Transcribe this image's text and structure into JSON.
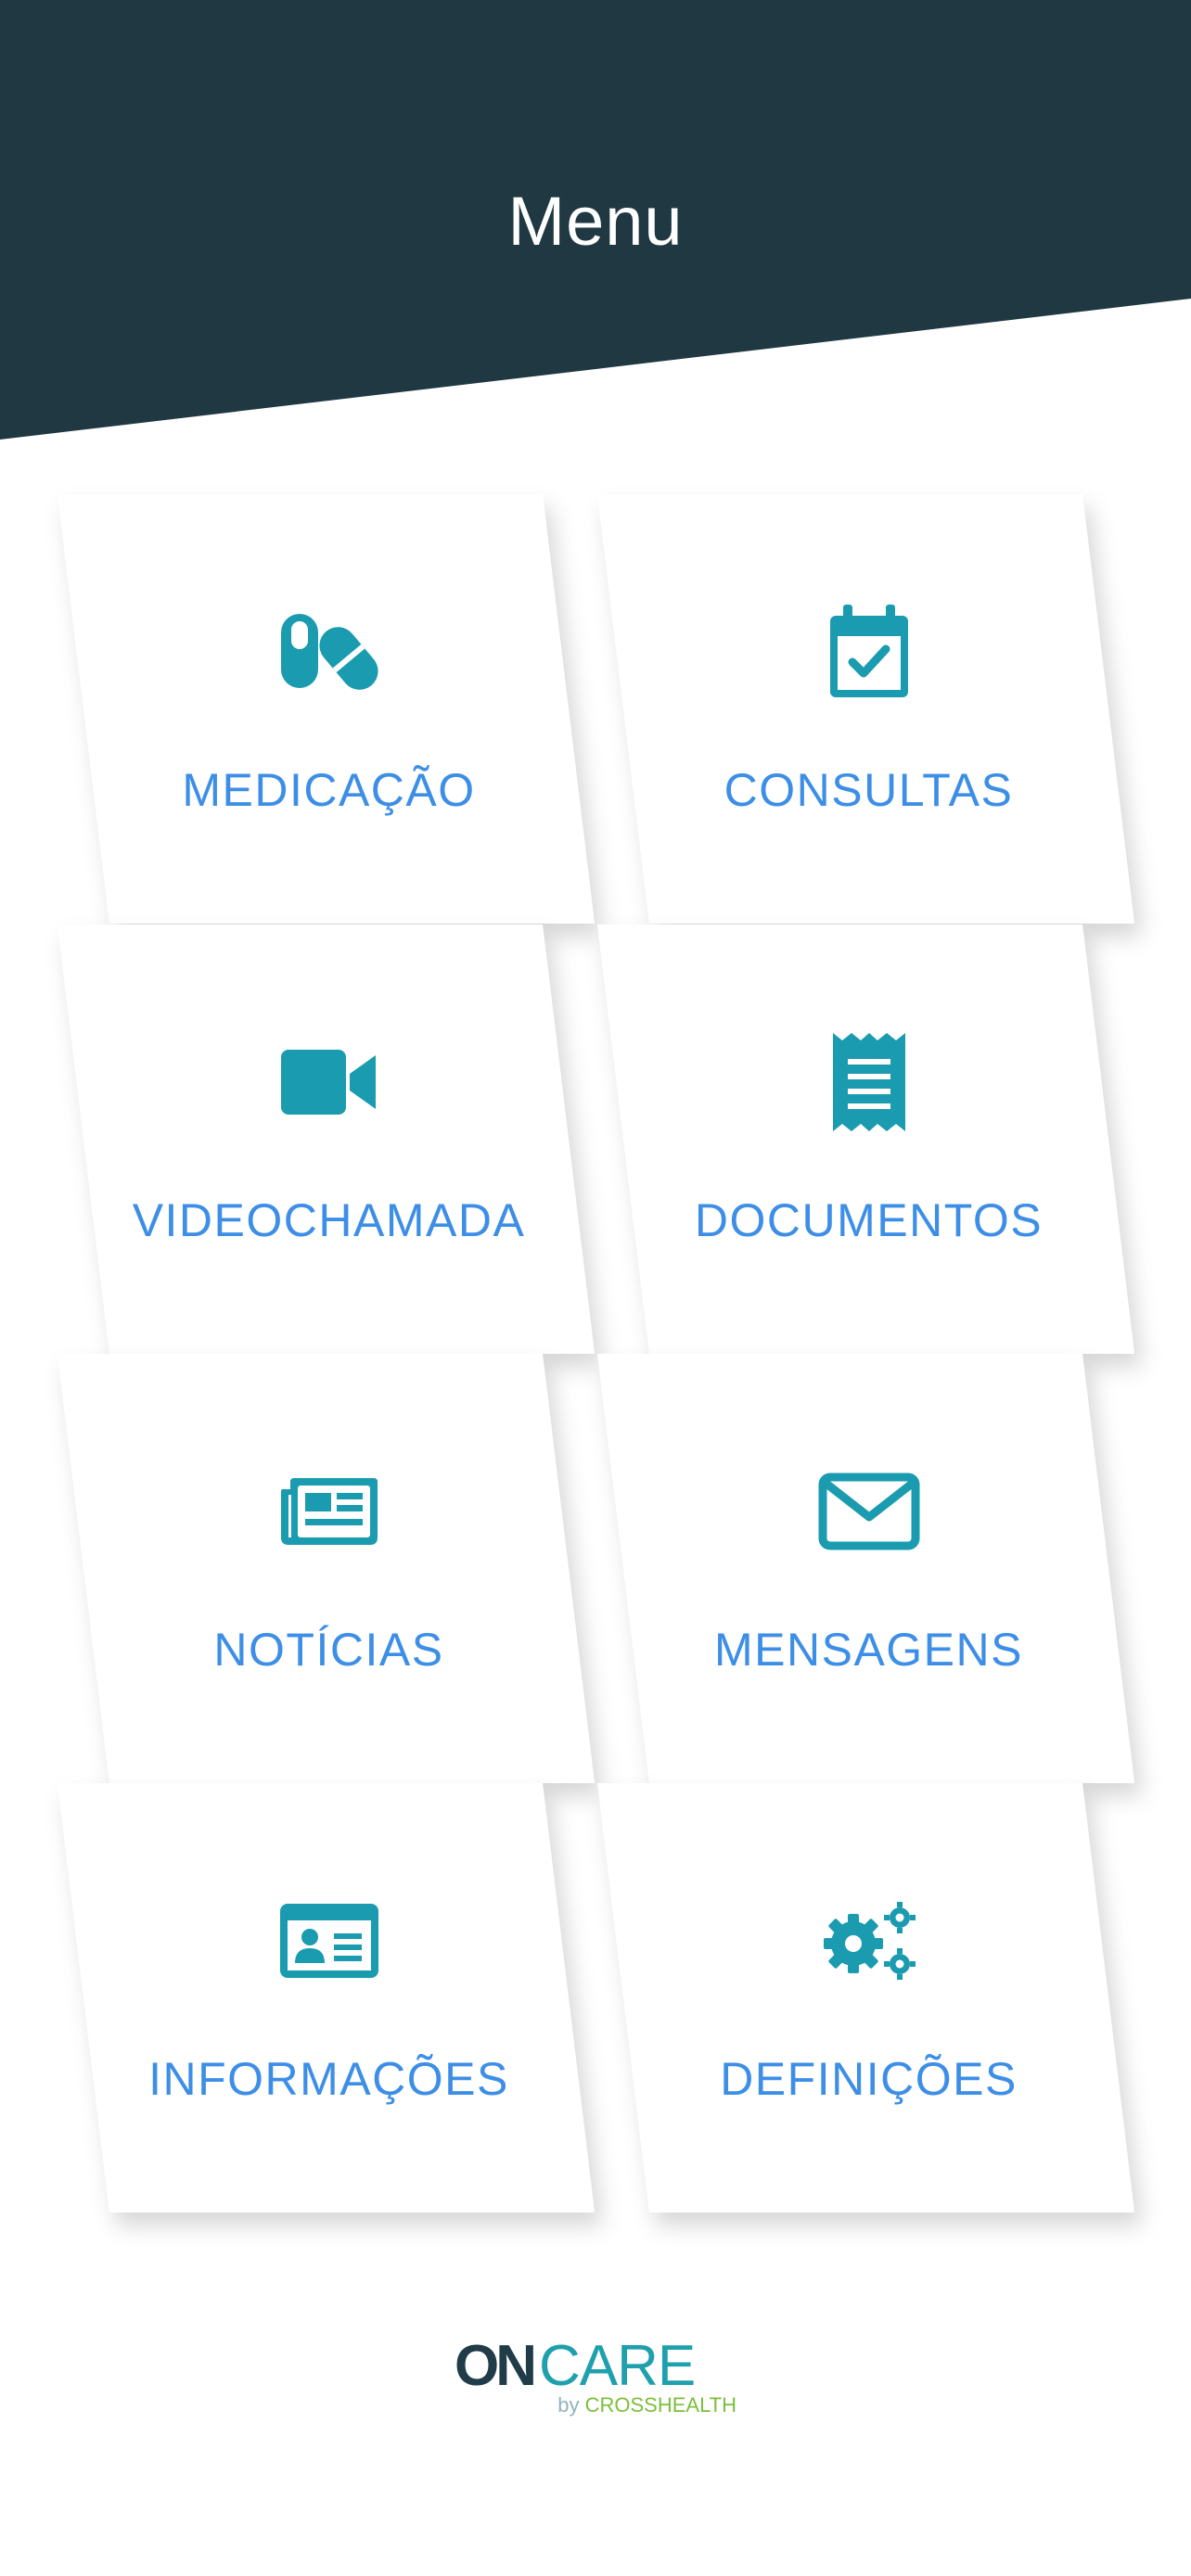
{
  "header": {
    "title": "Menu",
    "background_color": "#1f3842"
  },
  "menu": {
    "items": [
      {
        "label": "MEDICAÇÃO",
        "icon": "pills-icon"
      },
      {
        "label": "CONSULTAS",
        "icon": "calendar-check-icon"
      },
      {
        "label": "VIDEOCHAMADA",
        "icon": "video-camera-icon"
      },
      {
        "label": "DOCUMENTOS",
        "icon": "receipt-document-icon"
      },
      {
        "label": "NOTÍCIAS",
        "icon": "newspaper-icon"
      },
      {
        "label": "MENSAGENS",
        "icon": "envelope-icon"
      },
      {
        "label": "INFORMAÇÕES",
        "icon": "id-card-icon"
      },
      {
        "label": "DEFINIÇÕES",
        "icon": "gears-icon"
      }
    ],
    "label_color": "#3d8ee6",
    "icon_color": "#1a9baf"
  },
  "logo": {
    "part1": "ON",
    "part2": "CARE",
    "by": "by",
    "brand": "CROSSHEALTH"
  }
}
